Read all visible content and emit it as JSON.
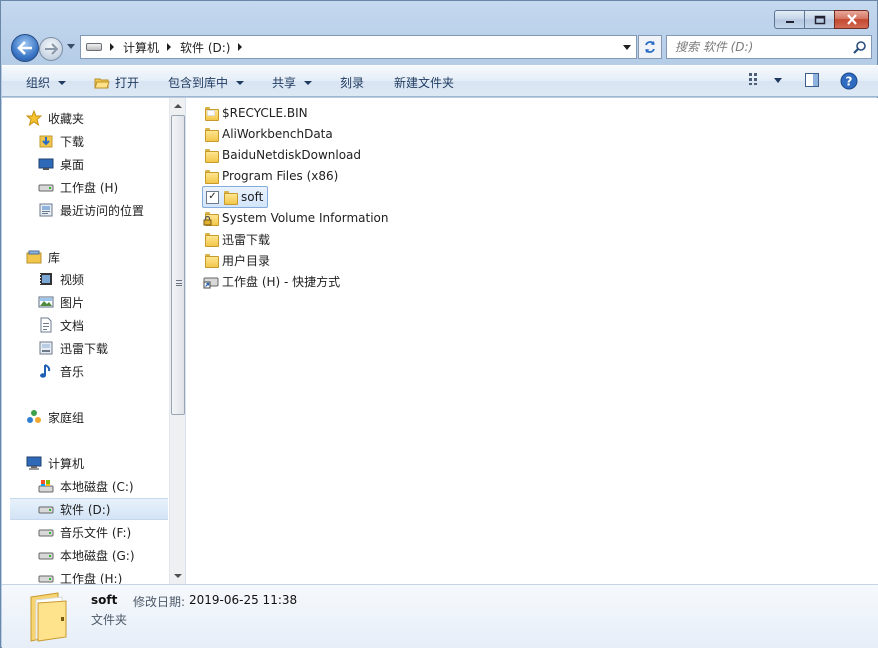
{
  "window": {
    "caption": {
      "minimize_icon": "minimize-icon",
      "maximize_icon": "maximize-icon",
      "close_icon": "close-icon"
    }
  },
  "navbar": {
    "breadcrumb": [
      "计算机",
      "软件 (D:)"
    ],
    "search_placeholder": "搜索 软件 (D:)"
  },
  "commandbar": {
    "organize": "组织",
    "open": "打开",
    "include_in_library": "包含到库中",
    "share": "共享",
    "burn": "刻录",
    "new_folder": "新建文件夹"
  },
  "navpane": {
    "favorites": {
      "label": "收藏夹",
      "items": [
        "下载",
        "桌面",
        "工作盘 (H)",
        "最近访问的位置"
      ]
    },
    "libraries": {
      "label": "库",
      "items": [
        "视频",
        "图片",
        "文档",
        "迅雷下载",
        "音乐"
      ]
    },
    "homegroup": {
      "label": "家庭组"
    },
    "computer": {
      "label": "计算机",
      "items": [
        "本地磁盘 (C:)",
        "软件 (D:)",
        "音乐文件 (F:)",
        "本地磁盘 (G:)",
        "工作盘 (H:)"
      ]
    },
    "selected": "软件 (D:)"
  },
  "files": [
    {
      "name": "$RECYCLE.BIN",
      "type": "folder"
    },
    {
      "name": "AliWorkbenchData",
      "type": "folder"
    },
    {
      "name": "BaiduNetdiskDownload",
      "type": "folder"
    },
    {
      "name": "Program Files (x86)",
      "type": "folder"
    },
    {
      "name": "soft",
      "type": "folder",
      "selected": true,
      "checked": true
    },
    {
      "name": "System Volume Information",
      "type": "locked-folder"
    },
    {
      "name": "迅雷下载",
      "type": "folder"
    },
    {
      "name": "用户目录",
      "type": "folder"
    },
    {
      "name": "工作盘 (H) - 快捷方式",
      "type": "shortcut"
    }
  ],
  "details": {
    "name": "soft",
    "modified_label": "修改日期:",
    "modified_value": "2019-06-25 11:38",
    "type": "文件夹"
  },
  "colors": {
    "accent": "#3c78c7",
    "selection": "#d3e5fb",
    "chrome": "#b9cfe9"
  }
}
